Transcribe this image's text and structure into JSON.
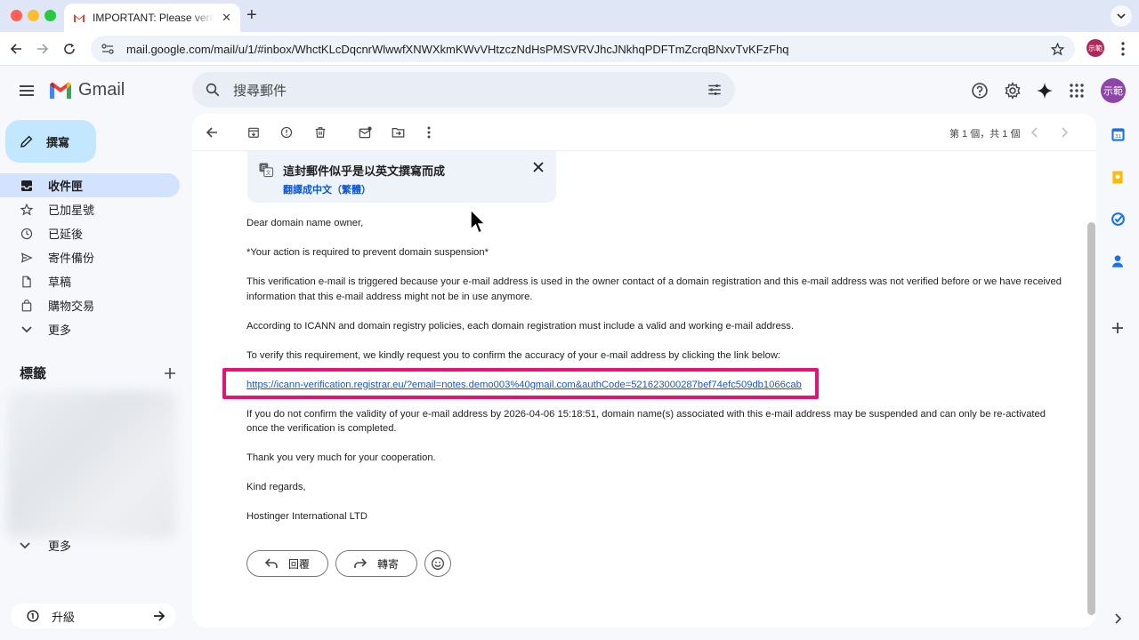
{
  "browser": {
    "tab_title": "IMPORTANT: Please verify your domain",
    "url": "mail.google.com/mail/u/1/#inbox/WhctKLcDqcnrWlwwfXNWXkmKWvVHtzczNdHsPMSVRVJhcJNkhqPDFTmZcrqBNxvTvKFzFhq",
    "profile_label": "示範"
  },
  "gmail": {
    "logo_text": "Gmail",
    "search_placeholder": "搜尋郵件",
    "avatar_label": "示範",
    "compose_label": "撰寫",
    "nav": [
      {
        "label": "收件匣",
        "icon": "inbox-icon",
        "active": true
      },
      {
        "label": "已加星號",
        "icon": "star-icon"
      },
      {
        "label": "已延後",
        "icon": "clock-icon"
      },
      {
        "label": "寄件備份",
        "icon": "send-icon"
      },
      {
        "label": "草稿",
        "icon": "draft-icon"
      },
      {
        "label": "購物交易",
        "icon": "shopping-icon"
      },
      {
        "label": "更多",
        "icon": "chevron-down-icon"
      }
    ],
    "labels_title": "標籤",
    "more_label": "更多",
    "upgrade_label": "升級"
  },
  "mail": {
    "pager": "第 1 個，共 1 個",
    "translate_title": "這封郵件似乎是以英文撰寫而成",
    "translate_link": "翻譯成中文（繁體）",
    "greeting": "Dear domain name owner,",
    "line1": "*Your action is required to prevent domain suspension*",
    "para1": "This verification e-mail is triggered because your e-mail address is used in the owner contact of a domain registration and this e-mail address was not verified before or we have received information that this e-mail address might not be in use anymore.",
    "para2": "According to ICANN and domain registry policies, each domain registration must include a valid and working e-mail address.",
    "para3": "To verify this requirement, we kindly request you to confirm the accuracy of your e-mail address by clicking the link below:",
    "link": "https://icann-verification.registrar.eu/?email=notes.demo003%40gmail.com&authCode=521623000287bef74efc509db1066cab",
    "para4": "If you do not confirm the validity of your e-mail address by 2026-04-06 15:18:51, domain name(s) associated with this e-mail address may be suspended and can only be re-activated once the verification is completed.",
    "thanks": "Thank you very much for your cooperation.",
    "regards": "Kind regards,",
    "signature": "Hostinger International LTD",
    "reply_label": "回覆",
    "forward_label": "轉寄"
  },
  "colors": {
    "highlight": "#e1147a",
    "link": "#1a57c6",
    "compose_bg": "#c2e7ff",
    "active_nav": "#d3e3fd"
  }
}
